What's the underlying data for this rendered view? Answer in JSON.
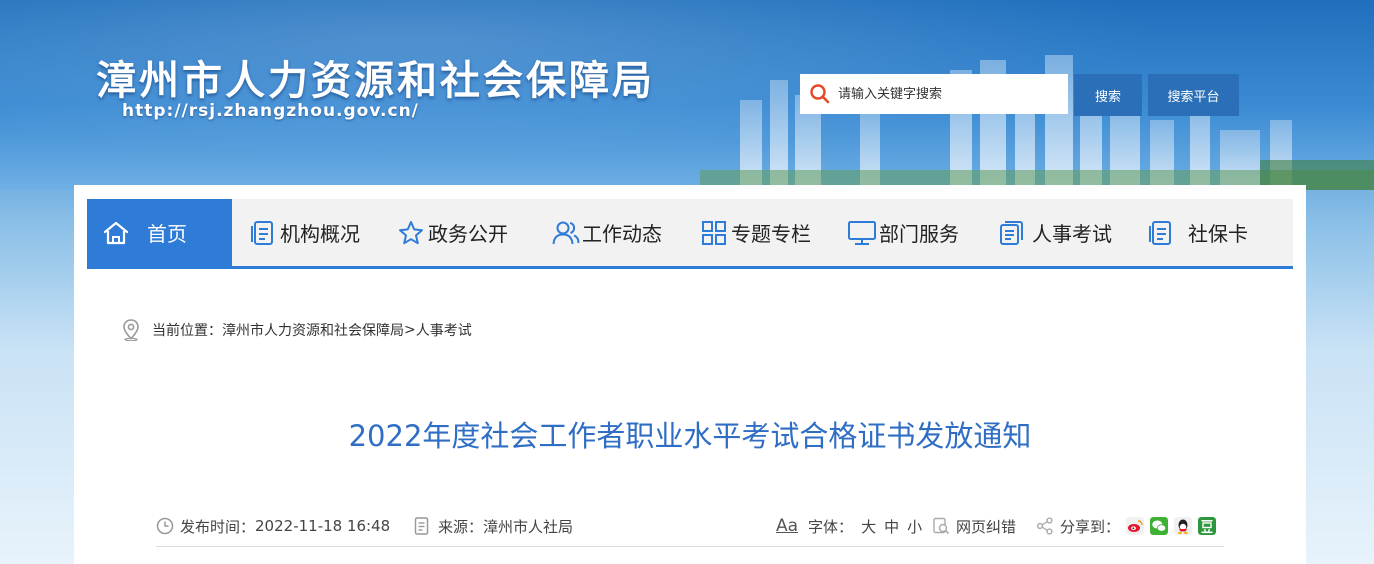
{
  "header": {
    "site_title": "漳州市人力资源和社会保障局",
    "site_url": "http://rsj.zhangzhou.gov.cn/"
  },
  "search": {
    "placeholder": "请输入关键字搜索",
    "search_label": "搜索",
    "platform_label": "搜索平台"
  },
  "nav": {
    "items": [
      {
        "label": "首页",
        "icon": "home-icon"
      },
      {
        "label": "机构概况",
        "icon": "document-icon"
      },
      {
        "label": "政务公开",
        "icon": "star-icon"
      },
      {
        "label": "工作动态",
        "icon": "users-icon"
      },
      {
        "label": "专题专栏",
        "icon": "grid-icon"
      },
      {
        "label": "部门服务",
        "icon": "monitor-icon"
      },
      {
        "label": "人事考试",
        "icon": "clipboard-icon"
      },
      {
        "label": "社保卡",
        "icon": "document-icon"
      }
    ]
  },
  "breadcrumb": {
    "prefix": "当前位置：",
    "home": "漳州市人力资源和社会保障局",
    "separator": ">",
    "current": "人事考试"
  },
  "article": {
    "title": "2022年度社会工作者职业水平考试合格证书发放通知",
    "publish_label": "发布时间：",
    "publish_time": "2022-11-18 16:48",
    "source_label": "来源：",
    "source": "漳州市人社局",
    "font_icon_text": "Aa",
    "font_label": "字体：",
    "font_large": "大",
    "font_medium": "中",
    "font_small": "小",
    "report_error": "网页纠错",
    "share_label": "分享到："
  },
  "colors": {
    "accent": "#2f7cd8",
    "title": "#2f6ec4",
    "button": "#2a6fb8"
  }
}
